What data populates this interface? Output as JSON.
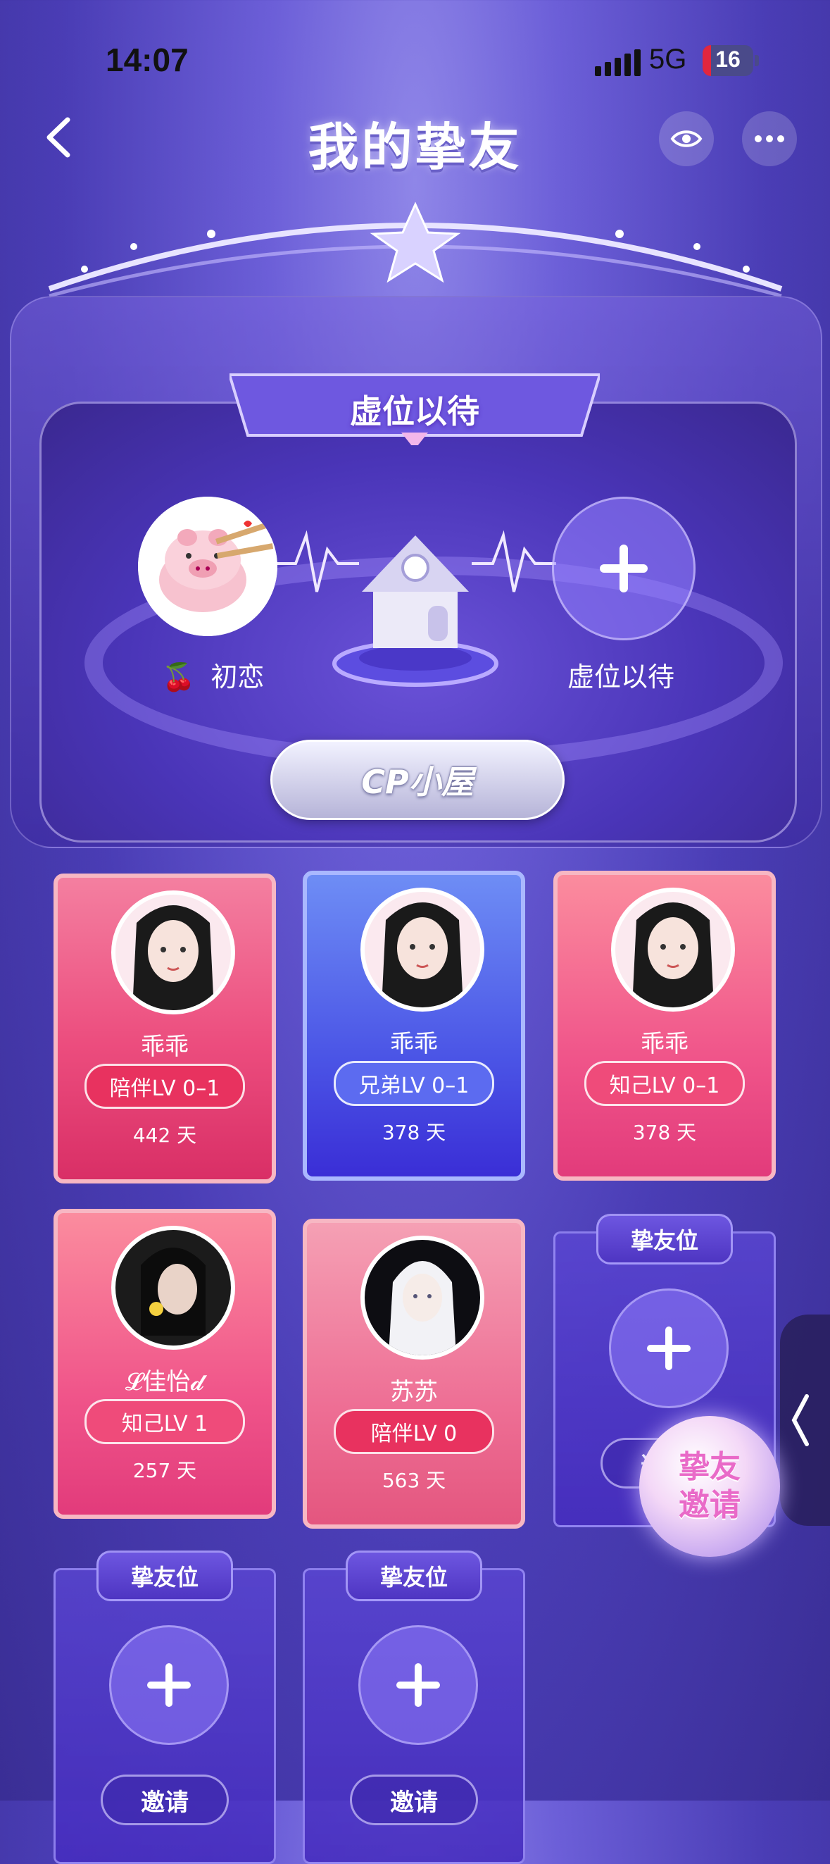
{
  "status_bar": {
    "time": "14:07",
    "network": "5G",
    "battery": "16",
    "battery_level": 0.16
  },
  "header": {
    "title": "我的挚友"
  },
  "cp_section": {
    "banner_title": "虚位以待",
    "left_member_name": "初恋",
    "right_slot_label": "虚位以待",
    "house_button": "CP小屋"
  },
  "friends": [
    {
      "name": "乖乖",
      "level": "陪伴LV 0–1",
      "days": "442 天",
      "theme": "pink"
    },
    {
      "name": "乖乖",
      "level": "兄弟LV 0–1",
      "days": "378 天",
      "theme": "blue"
    },
    {
      "name": "乖乖",
      "level": "知己LV 0–1",
      "days": "378 天",
      "theme": "rose"
    },
    {
      "name": "𝓛佳怡𝓭",
      "level": "知己LV 1",
      "days": "257 天",
      "theme": "rose"
    },
    {
      "name": "苏苏",
      "level": "陪伴LV 0",
      "days": "563 天",
      "theme": "pink"
    }
  ],
  "empty_slots": [
    {
      "tag": "挚友位",
      "invite": "邀请"
    },
    {
      "tag": "挚友位",
      "invite": "邀请"
    },
    {
      "tag": "挚友位",
      "invite": "邀请"
    }
  ],
  "fab": {
    "line1": "挚友",
    "line2": "邀请"
  },
  "colors": {
    "pink_card": "#ec4d7e",
    "blue_card": "#4b55e6",
    "background": "#4a3db5"
  }
}
